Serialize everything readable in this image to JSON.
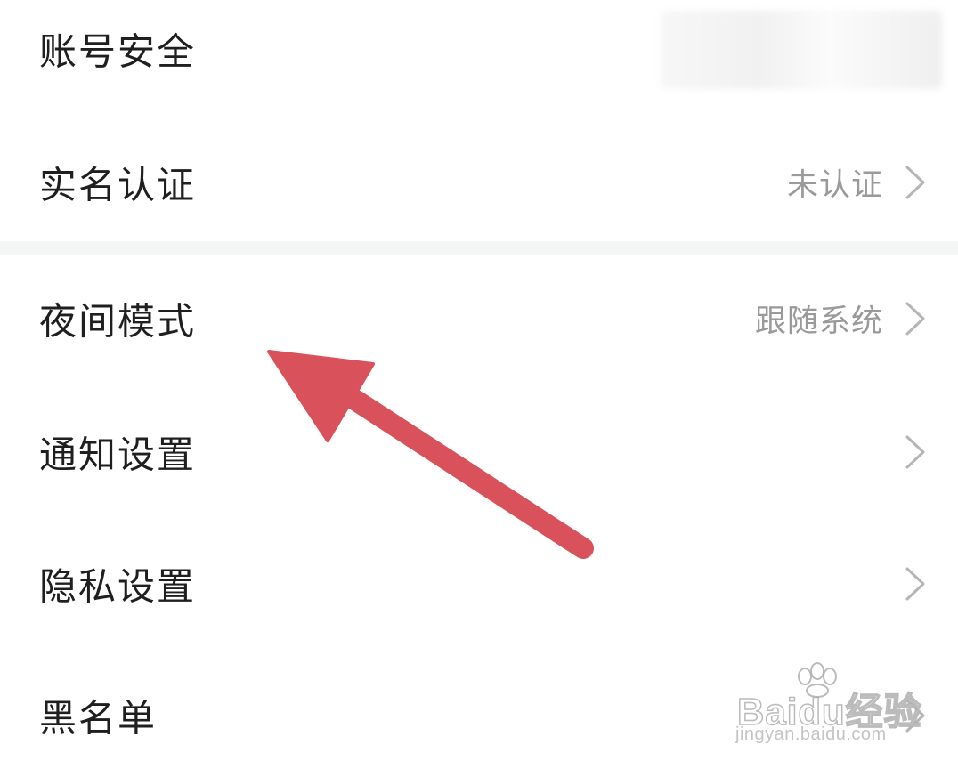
{
  "settings": {
    "items": [
      {
        "label": "账号安全",
        "value": ""
      },
      {
        "label": "实名认证",
        "value": "未认证"
      },
      {
        "label": "夜间模式",
        "value": "跟随系统"
      },
      {
        "label": "通知设置",
        "value": ""
      },
      {
        "label": "隐私设置",
        "value": ""
      },
      {
        "label": "黑名单",
        "value": ""
      }
    ]
  },
  "annotation": {
    "arrow_color": "#d9525b"
  },
  "watermark": {
    "brand": "Baidu经验",
    "url": "jingyan.baidu.com"
  },
  "colors": {
    "label": "#1f1f1f",
    "value": "#9a9a9a",
    "chevron": "#b5b5b5",
    "divider": "#f4f6f5"
  }
}
